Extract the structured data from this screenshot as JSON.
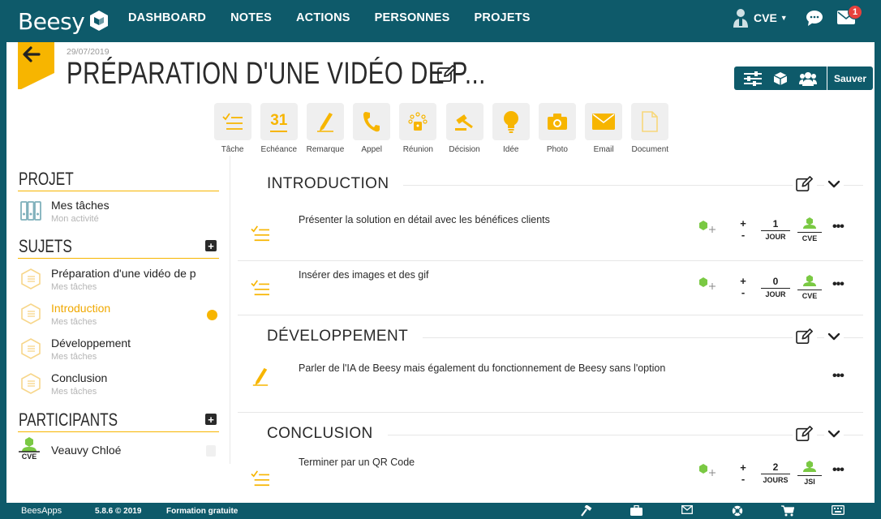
{
  "app": {
    "logo_text": "Beesy",
    "nav": [
      "DASHBOARD",
      "NOTES",
      "ACTIONS",
      "PERSONNES",
      "PROJETS"
    ],
    "user": "CVE",
    "notification_count": "1"
  },
  "note": {
    "date": "29/07/2019",
    "title": "PRÉPARATION D'UNE VIDÉO DE P..."
  },
  "toolbar": {
    "save_label": "Sauver"
  },
  "item_types": [
    {
      "label": "Tâche",
      "icon": "task-icon"
    },
    {
      "label": "Echéance",
      "icon": "calendar-icon",
      "glyph": "31"
    },
    {
      "label": "Remarque",
      "icon": "pencil-icon"
    },
    {
      "label": "Appel",
      "icon": "phone-icon"
    },
    {
      "label": "Réunion",
      "icon": "meeting-icon"
    },
    {
      "label": "Décision",
      "icon": "gavel-icon"
    },
    {
      "label": "Idée",
      "icon": "lightbulb-icon"
    },
    {
      "label": "Photo",
      "icon": "camera-icon"
    },
    {
      "label": "Email",
      "icon": "envelope-icon"
    },
    {
      "label": "Document",
      "icon": "document-icon"
    }
  ],
  "sidebar": {
    "projet": {
      "title": "PROJET",
      "item": {
        "name": "Mes tâches",
        "sub": "Mon activité"
      }
    },
    "sujets": {
      "title": "SUJETS",
      "items": [
        {
          "name": "Préparation d'une vidéo de p",
          "sub": "Mes tâches"
        },
        {
          "name": "Introduction",
          "sub": "Mes tâches"
        },
        {
          "name": "Développement",
          "sub": "Mes tâches"
        },
        {
          "name": "Conclusion",
          "sub": "Mes tâches"
        }
      ]
    },
    "participants": {
      "title": "PARTICIPANTS",
      "items": [
        {
          "initials": "CVE",
          "name": "Veauvy Chloé"
        }
      ]
    }
  },
  "sections": [
    {
      "title": "INTRODUCTION",
      "rows": [
        {
          "text": "Présenter la solution en détail avec les bénéfices clients",
          "due_n": "1",
          "due_u": "JOUR",
          "owner": "CVE"
        },
        {
          "text": "Insérer des images et des gif",
          "due_n": "0",
          "due_u": "JOUR",
          "owner": "CVE"
        }
      ]
    },
    {
      "title": "DÉVELOPPEMENT",
      "rows": [
        {
          "text": "Parler de l'IA de Beesy mais également du fonctionnement de Beesy sans l'option"
        }
      ]
    },
    {
      "title": "CONCLUSION",
      "rows": [
        {
          "text": "Terminer par un QR Code",
          "due_n": "2",
          "due_u": "JOURS",
          "owner": "JSI"
        }
      ]
    }
  ],
  "footer": {
    "brand": "BeesApps",
    "version": "5.8.6 © 2019",
    "plan": "Formation gratuite"
  },
  "colors": {
    "brand": "#0e5a6a",
    "accent": "#f7b500",
    "green": "#7ac943"
  }
}
